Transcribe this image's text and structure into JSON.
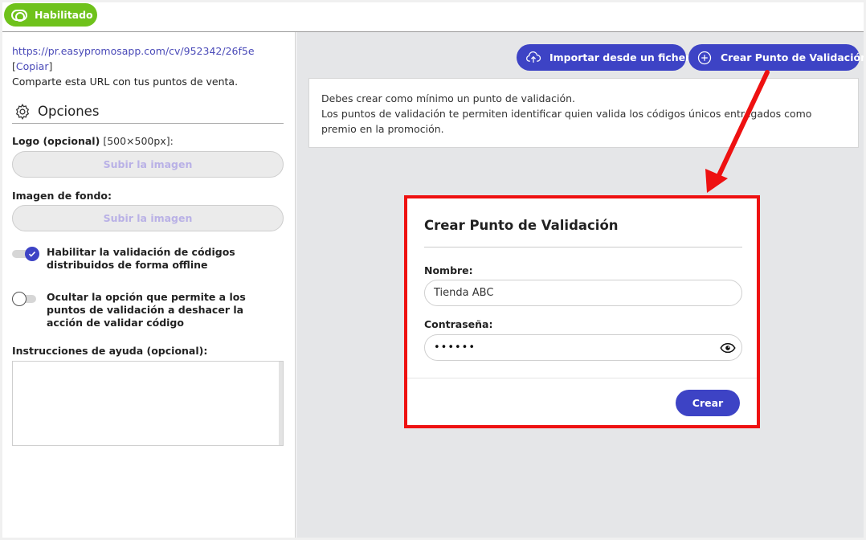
{
  "header": {
    "status_label": "Habilitado"
  },
  "left": {
    "url": "https://pr.easypromosapp.com/cv/952342/26f5e",
    "copy_open": "[",
    "copy_label": "Copiar",
    "copy_close": "]",
    "share_text": "Comparte esta URL con tus puntos de venta.",
    "options_title": "Opciones",
    "logo_label": "Logo (opcional)",
    "logo_hint": "[500×500px]:",
    "upload_label": "Subir la imagen",
    "background_label": "Imagen de fondo:",
    "switch_offline_label": "Habilitar la validación de códigos distribuidos de forma offline",
    "switch_offline_on": true,
    "switch_undo_label": "Ocultar la opción que permite a los puntos de validación a deshacer la acción de validar código",
    "switch_undo_on": false,
    "instructions_label": "Instrucciones de ayuda (opcional):",
    "instructions_value": ""
  },
  "toolbar": {
    "import_label": "Importar desde un fichero",
    "create_point_label": "Crear Punto de Validación"
  },
  "info": {
    "line1": "Debes crear como mínimo un punto de validación.",
    "line2": "Los puntos de validación te permiten identificar quien valida los códigos únicos entregados como premio en la promoción."
  },
  "modal": {
    "title": "Crear Punto de Validación",
    "name_label": "Nombre:",
    "name_value": "Tienda ABC",
    "password_label": "Contraseña:",
    "password_value": "••••••",
    "submit_label": "Crear"
  },
  "colors": {
    "accent": "#3d43c5",
    "enabled": "#6fc21b",
    "highlight": "#ee1111",
    "panel_bg": "#e5e6e8"
  },
  "icons": [
    "toggle-icon",
    "gear-icon",
    "check-icon",
    "cloud-upload-icon",
    "plus-circle-icon",
    "eye-icon",
    "arrow-annotation"
  ]
}
